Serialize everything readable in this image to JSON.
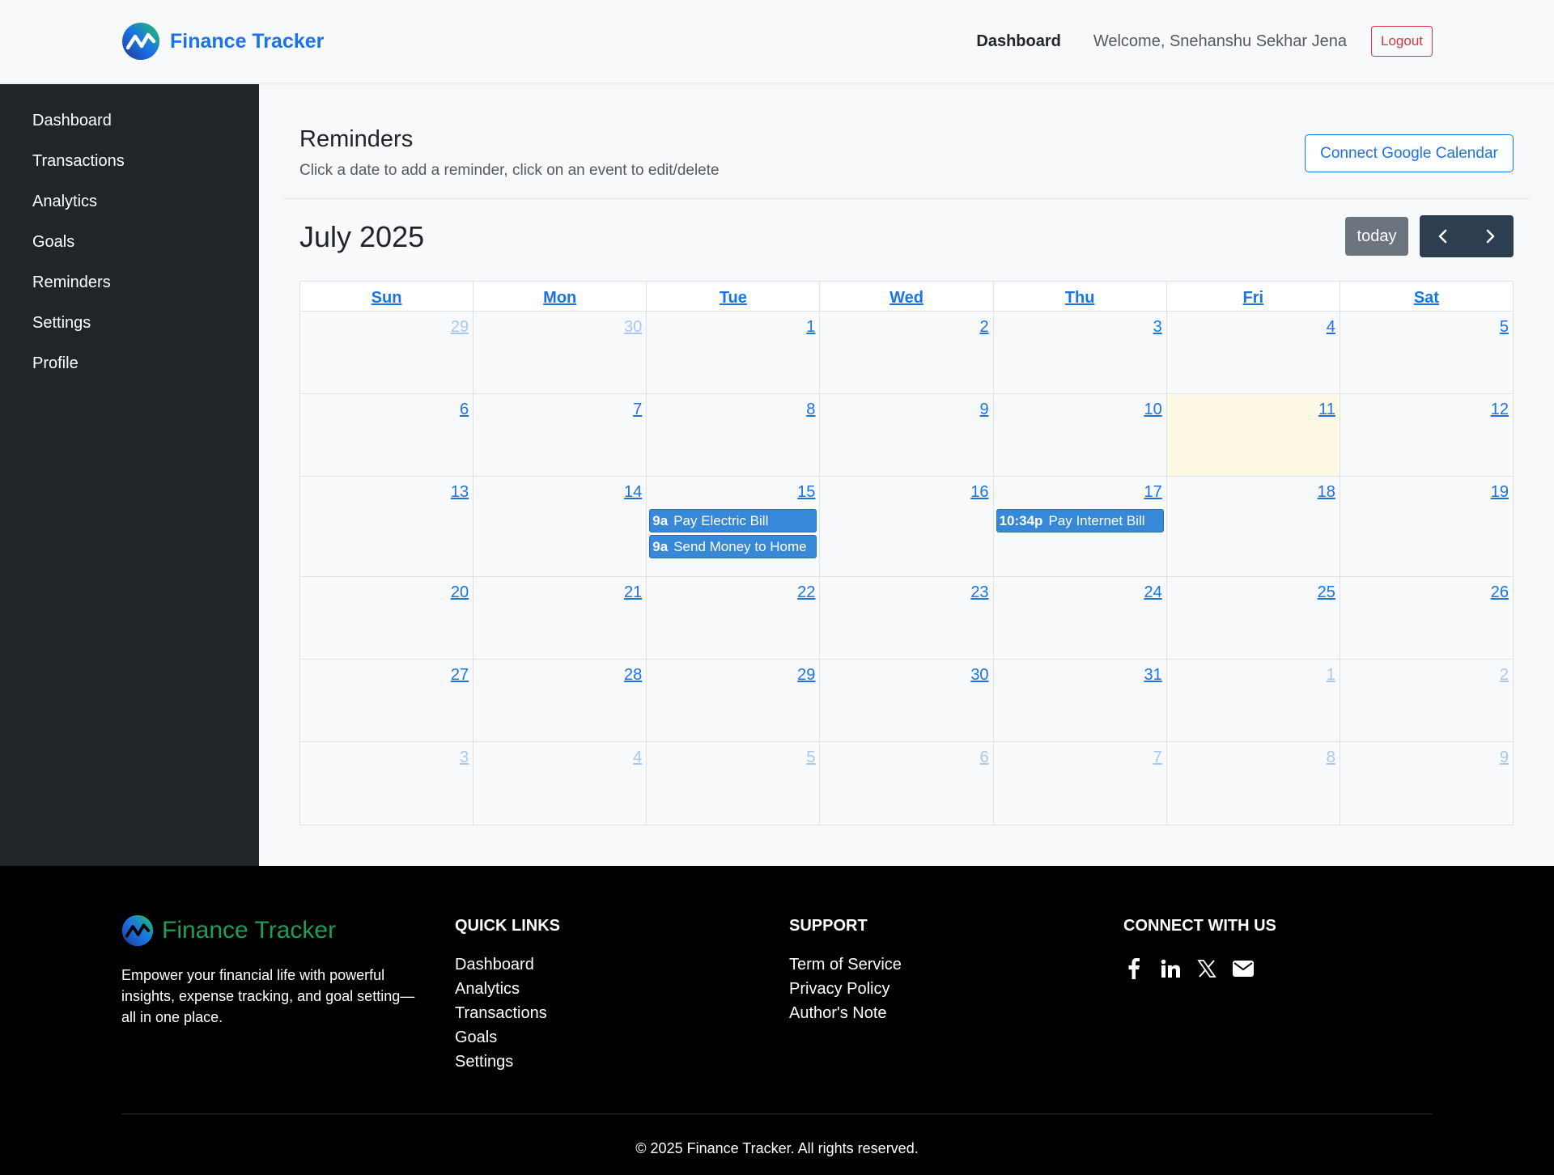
{
  "header": {
    "brand": "Finance Tracker",
    "nav_link": "Dashboard",
    "welcome": "Welcome, Snehanshu Sekhar Jena",
    "logout": "Logout"
  },
  "sidebar": {
    "items": [
      {
        "label": "Dashboard"
      },
      {
        "label": "Transactions"
      },
      {
        "label": "Analytics"
      },
      {
        "label": "Goals"
      },
      {
        "label": "Reminders"
      },
      {
        "label": "Settings"
      },
      {
        "label": "Profile"
      }
    ]
  },
  "main": {
    "title": "Reminders",
    "subtitle": "Click a date to add a reminder, click on an event to edit/delete",
    "google_button": "Connect Google Calendar"
  },
  "calendar": {
    "month_title": "July 2025",
    "today_label": "today",
    "prev_icon": "chevron-left-icon",
    "next_icon": "chevron-right-icon",
    "today_date": "11",
    "days_of_week": [
      "Sun",
      "Mon",
      "Tue",
      "Wed",
      "Thu",
      "Fri",
      "Sat"
    ],
    "weeks": [
      [
        {
          "d": "29",
          "other": true
        },
        {
          "d": "30",
          "other": true
        },
        {
          "d": "1"
        },
        {
          "d": "2"
        },
        {
          "d": "3"
        },
        {
          "d": "4"
        },
        {
          "d": "5"
        }
      ],
      [
        {
          "d": "6"
        },
        {
          "d": "7"
        },
        {
          "d": "8"
        },
        {
          "d": "9"
        },
        {
          "d": "10"
        },
        {
          "d": "11",
          "today": true
        },
        {
          "d": "12"
        }
      ],
      [
        {
          "d": "13"
        },
        {
          "d": "14"
        },
        {
          "d": "15",
          "events": [
            {
              "time": "9a",
              "title": "Pay Electric Bill"
            },
            {
              "time": "9a",
              "title": "Send Money to Home"
            }
          ]
        },
        {
          "d": "16"
        },
        {
          "d": "17",
          "events": [
            {
              "time": "10:34p",
              "title": "Pay Internet Bill"
            }
          ]
        },
        {
          "d": "18"
        },
        {
          "d": "19"
        }
      ],
      [
        {
          "d": "20"
        },
        {
          "d": "21"
        },
        {
          "d": "22"
        },
        {
          "d": "23"
        },
        {
          "d": "24"
        },
        {
          "d": "25"
        },
        {
          "d": "26"
        }
      ],
      [
        {
          "d": "27"
        },
        {
          "d": "28"
        },
        {
          "d": "29"
        },
        {
          "d": "30"
        },
        {
          "d": "31"
        },
        {
          "d": "1",
          "other": true
        },
        {
          "d": "2",
          "other": true
        }
      ],
      [
        {
          "d": "3",
          "other": true
        },
        {
          "d": "4",
          "other": true
        },
        {
          "d": "5",
          "other": true
        },
        {
          "d": "6",
          "other": true
        },
        {
          "d": "7",
          "other": true
        },
        {
          "d": "8",
          "other": true
        },
        {
          "d": "9",
          "other": true
        }
      ]
    ]
  },
  "footer": {
    "brand": "Finance Tracker",
    "description": "Empower your financial life with powerful insights, expense tracking, and goal setting—all in one place.",
    "quick_links_title": "QUICK LINKS",
    "quick_links": [
      "Dashboard",
      "Analytics",
      "Transactions",
      "Goals",
      "Settings"
    ],
    "support_title": "SUPPORT",
    "support_links": [
      "Term of Service",
      "Privacy Policy",
      "Author's Note"
    ],
    "connect_title": "CONNECT WITH US",
    "social_icons": [
      "facebook-icon",
      "linkedin-icon",
      "x-icon",
      "mail-icon"
    ],
    "copyright": "© 2025 Finance Tracker. All rights reserved."
  },
  "colors": {
    "accent": "#1a73e8",
    "sidebar_bg": "#212529",
    "event_bg": "#3788d8",
    "today_bg": "#fcf8e3",
    "logout": "#dc3545"
  }
}
